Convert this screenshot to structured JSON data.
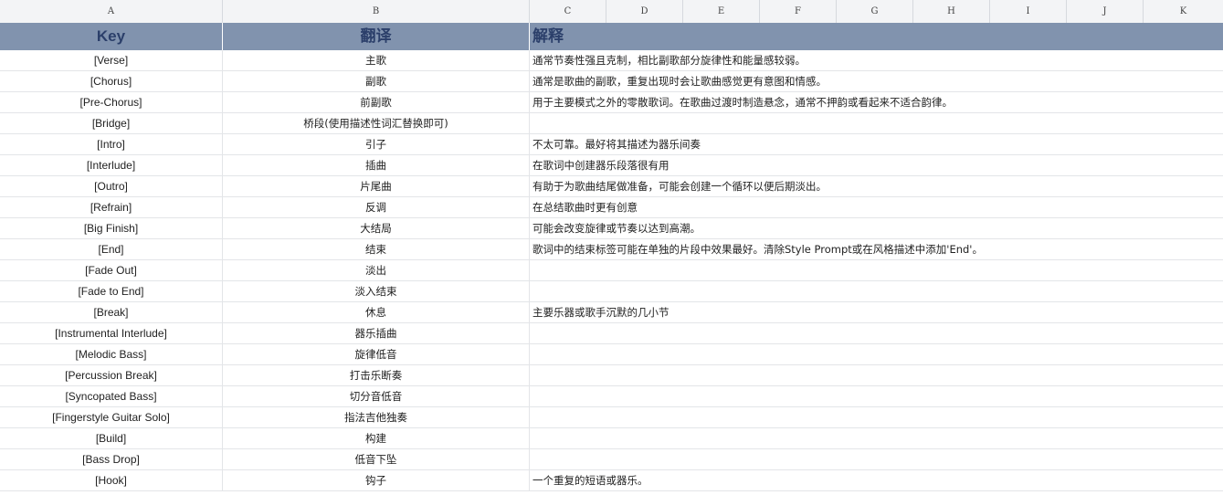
{
  "columns": [
    "A",
    "B",
    "C",
    "D",
    "E",
    "F",
    "G",
    "H",
    "I",
    "J",
    "K"
  ],
  "header": {
    "key": "Key",
    "translation": "翻译",
    "explanation": "解释"
  },
  "rows": [
    {
      "key": "[Verse]",
      "translation": "主歌",
      "explanation": "通常节奏性强且克制，相比副歌部分旋律性和能量感较弱。"
    },
    {
      "key": "[Chorus]",
      "translation": "副歌",
      "explanation": "通常是歌曲的副歌，重复出现时会让歌曲感觉更有意图和情感。"
    },
    {
      "key": "[Pre-Chorus]",
      "translation": "前副歌",
      "explanation": "用于主要模式之外的零散歌词。在歌曲过渡时制造悬念，通常不押韵或看起来不适合韵律。"
    },
    {
      "key": "[Bridge]",
      "translation": "桥段(使用描述性词汇替换即可)",
      "explanation": ""
    },
    {
      "key": "[Intro]",
      "translation": "引子",
      "explanation": "不太可靠。最好将其描述为器乐间奏"
    },
    {
      "key": "[Interlude]",
      "translation": "插曲",
      "explanation": "在歌词中创建器乐段落很有用"
    },
    {
      "key": "[Outro]",
      "translation": "片尾曲",
      "explanation": "有助于为歌曲结尾做准备，可能会创建一个循环以便后期淡出。"
    },
    {
      "key": "[Refrain]",
      "translation": "反调",
      "explanation": "在总结歌曲时更有创意"
    },
    {
      "key": "[Big Finish]",
      "translation": "大结局",
      "explanation": "可能会改变旋律或节奏以达到高潮。"
    },
    {
      "key": "[End]",
      "translation": "结束",
      "explanation": "歌词中的结束标签可能在单独的片段中效果最好。清除Style Prompt或在风格描述中添加'End'。"
    },
    {
      "key": "[Fade Out]",
      "translation": "淡出",
      "explanation": ""
    },
    {
      "key": "[Fade to End]",
      "translation": "淡入结束",
      "explanation": ""
    },
    {
      "key": "[Break]",
      "translation": "休息",
      "explanation": "主要乐器或歌手沉默的几小节"
    },
    {
      "key": "[Instrumental Interlude]",
      "translation": "器乐插曲",
      "explanation": ""
    },
    {
      "key": "[Melodic Bass]",
      "translation": "旋律低音",
      "explanation": ""
    },
    {
      "key": "[Percussion Break]",
      "translation": "打击乐断奏",
      "explanation": ""
    },
    {
      "key": "[Syncopated Bass]",
      "translation": "切分音低音",
      "explanation": ""
    },
    {
      "key": "[Fingerstyle Guitar Solo]",
      "translation": "指法吉他独奏",
      "explanation": ""
    },
    {
      "key": "[Build]",
      "translation": "构建",
      "explanation": ""
    },
    {
      "key": "[Bass Drop]",
      "translation": "低音下坠",
      "explanation": ""
    },
    {
      "key": "[Hook]",
      "translation": "钩子",
      "explanation": "一个重复的短语或器乐。"
    }
  ],
  "colors": {
    "header_bg": "#8193ae",
    "header_text": "#2b3f6a",
    "colhdr_bg": "#f3f4f6",
    "grid": "#e3e5e8"
  }
}
